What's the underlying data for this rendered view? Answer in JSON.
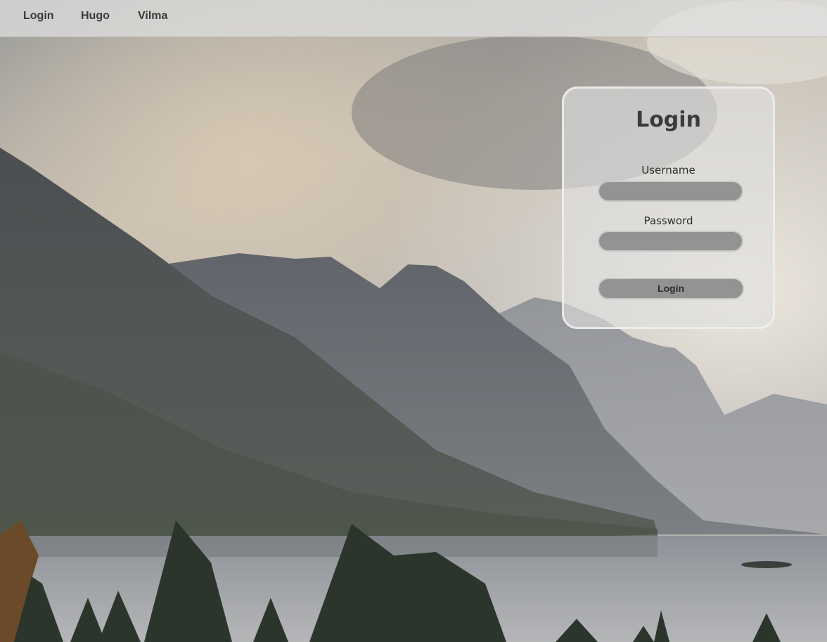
{
  "nav": {
    "links": [
      {
        "label": "Login"
      },
      {
        "label": "Hugo"
      },
      {
        "label": "Vilma"
      }
    ]
  },
  "login_form": {
    "title": "Login",
    "username_label": "Username",
    "username_value": "",
    "password_label": "Password",
    "password_value": "",
    "submit_label": "Login"
  },
  "background": {
    "image": "mountain-lake-landscape",
    "colors": {
      "sky": "#c9c3b8",
      "mountain_far": "#8c8f95",
      "mountain_near": "#5a5e5e",
      "lake": "#a9adb3",
      "trees": "#2f3b2f"
    }
  }
}
